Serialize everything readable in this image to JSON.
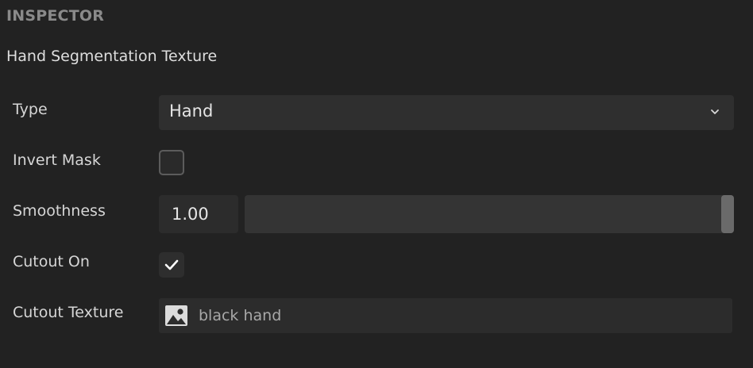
{
  "header": {
    "title": "INSPECTOR"
  },
  "component": {
    "title": "Hand Segmentation Texture"
  },
  "properties": {
    "type": {
      "label": "Type",
      "value": "Hand",
      "icon": "chevron-down-icon"
    },
    "invert_mask": {
      "label": "Invert Mask",
      "checked": false
    },
    "smoothness": {
      "label": "Smoothness",
      "value": "1.00",
      "slider_fraction": 1.0
    },
    "cutout_on": {
      "label": "Cutout On",
      "checked": true,
      "icon": "checkmark-icon"
    },
    "cutout_texture": {
      "label": "Cutout Texture",
      "value": "black hand",
      "icon": "image-icon"
    }
  },
  "colors": {
    "background": "#222222",
    "field": "#2c2c2c",
    "header_text": "#8a8a8a",
    "label_text": "#d6d6d6"
  }
}
